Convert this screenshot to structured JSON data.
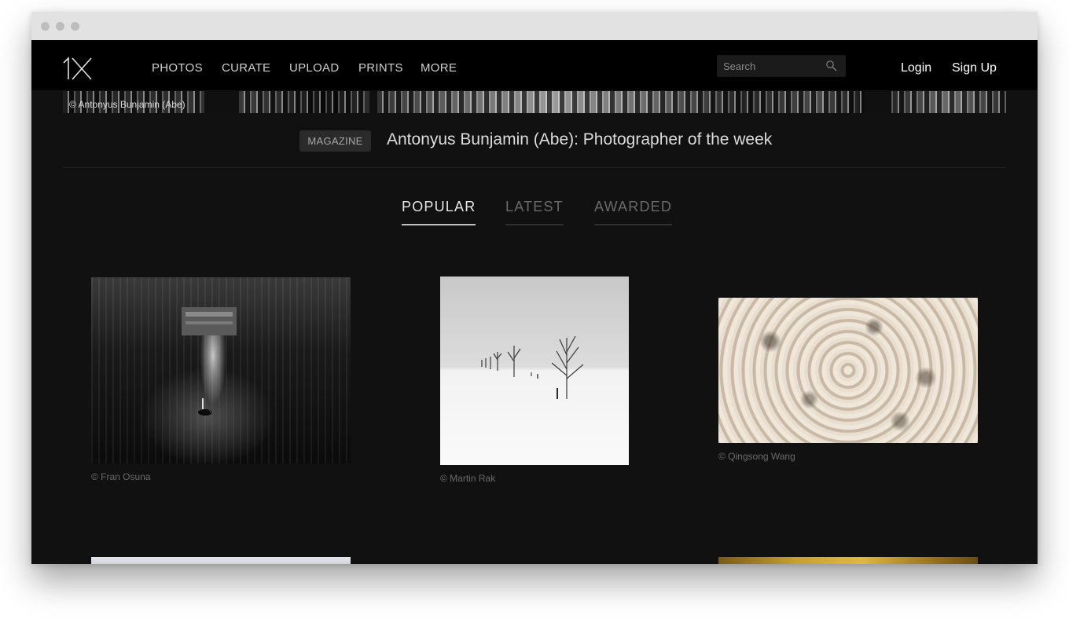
{
  "nav": {
    "items": [
      {
        "label": "PHOTOS"
      },
      {
        "label": "CURATE"
      },
      {
        "label": "UPLOAD"
      },
      {
        "label": "PRINTS"
      },
      {
        "label": "MORE"
      }
    ],
    "search_placeholder": "Search",
    "login_label": "Login",
    "signup_label": "Sign Up"
  },
  "hero": {
    "credit": "© Antonyus Bunjamin (Abe)"
  },
  "magazine": {
    "badge": "MAGAZINE",
    "title": "Antonyus Bunjamin (Abe): Photographer of the week"
  },
  "tabs": [
    {
      "label": "POPULAR",
      "active": true
    },
    {
      "label": "LATEST",
      "active": false
    },
    {
      "label": "AWARDED",
      "active": false
    }
  ],
  "photos": [
    {
      "credit": "© Fran Osuna"
    },
    {
      "credit": "© Martin Rak"
    },
    {
      "credit": "© Qingsong Wang"
    }
  ],
  "colors": {
    "page_bg": "#111111",
    "navbar_bg": "#000000",
    "nav_text": "#cfcfcf",
    "credit_text": "#6b6b6b"
  }
}
